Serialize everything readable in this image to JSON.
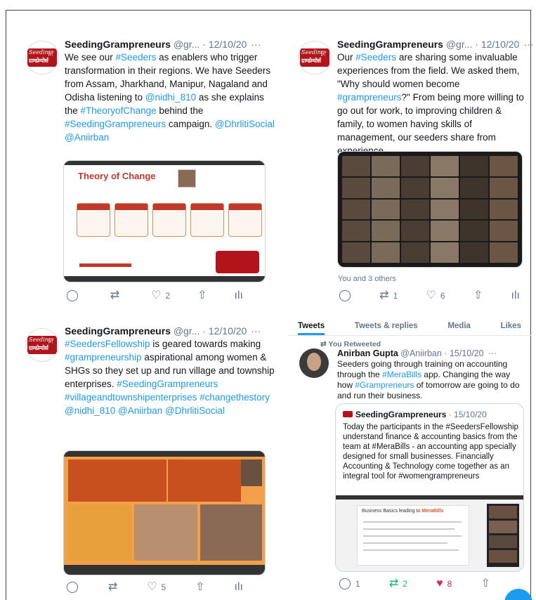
{
  "tweet1": {
    "name": "SeedingGrampreneurs",
    "handle_date": " @gr... · 12/10/20",
    "more": "···",
    "text_parts": [
      "We see our ",
      "#Seeders",
      " as enablers who trigger transformation in their regions. We have Seeders from Assam, Jharkhand, Manipur, Nagaland and Odisha listening to ",
      "@nidhi_810",
      " as she explains the ",
      "#TheoryofChange",
      " behind the ",
      "#SeedingGrampreneurs",
      " campaign. ",
      "@DhrlitiSocial @Aniirban"
    ],
    "media_title": "Theory of Change",
    "replies": "",
    "retweets": "",
    "likes": "2"
  },
  "tweet2": {
    "name": "SeedingGrampreneurs",
    "handle_date": " @gr... · 12/10/20",
    "more": "···",
    "text_parts": [
      "Our ",
      "#Seeders",
      " are sharing some invaluable experiences from the field. We asked them, \"Why should women become ",
      "#grampreneurs",
      "?\" From being more willing to go out for work, to improving children & family, to women having skills of management, our seeders share from experience."
    ],
    "liked_by": "You and 3 others",
    "retweets": "1",
    "likes": "6"
  },
  "tweet3": {
    "name": "SeedingGrampreneurs",
    "handle_date": " @gr... · 12/10/20",
    "more": "···",
    "text_parts": [
      "#SeedersFellowship",
      " is geared towards making ",
      "#grampreneurship",
      " aspirational among women & SHGs so they set up and run village and township enterprises. ",
      "#SeedingGrampreneurs #villageandtownshipenterprises #changethestory @nidhi_810 @Aniirban @DhrlitiSocial"
    ],
    "likes": "5"
  },
  "profile_tabs": [
    "Tweets",
    "Tweets & replies",
    "Media",
    "Likes"
  ],
  "retweet": {
    "label": "You Retweeted",
    "name": "Anirban Gupta",
    "handle_date": " @Aniirban · 15/10/20",
    "more": "···",
    "text_parts": [
      "Seeders going through training on accounting through the ",
      "#MeraBills",
      " app. Changing the way how ",
      "#Grampreneurs",
      " of tomorrow are going to do and run their business."
    ],
    "quote_name": "SeedingGrampreneurs",
    "quote_date": " · 15/10/20",
    "quote_text": "Today the participants in the #SeedersFellowship understand finance & accounting basics from the team at #MeraBills - an accounting app specially designed for small businesses. Financially Accounting & Technology come together as an integral tool for #womengrampreneurs",
    "slide_title": "Business Basics leading to",
    "slide_brand": "MeraBills",
    "replies": "1",
    "retweets": "2",
    "likes": "8"
  },
  "colors": {
    "link": "#1d9bf0",
    "brand_red": "#b3141b",
    "retweet_green": "#17bf63",
    "like_red": "#e0245e"
  }
}
